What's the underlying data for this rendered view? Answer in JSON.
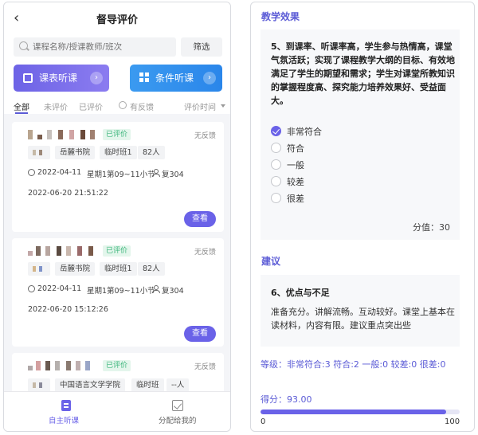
{
  "header": {
    "title": "督导评价"
  },
  "search": {
    "placeholder": "课程名称/授课教师/班次",
    "filter_label": "筛选"
  },
  "big_buttons": {
    "schedule": "课表听课",
    "condition": "条件听课"
  },
  "tabs": [
    "全部",
    "未评价",
    "已评价",
    "有反馈",
    "评价时间"
  ],
  "cards": [
    {
      "badge": "已评价",
      "feedback": "无反馈",
      "tags": [
        "岳麓书院",
        "临时班1",
        "82人"
      ],
      "date": "2022-04-11",
      "period": "星期1第09~11小节",
      "room": "复304",
      "timestamp": "2022-06-20 21:51:22",
      "action": "查看"
    },
    {
      "badge": "已评价",
      "feedback": "无反馈",
      "tags": [
        "岳麓书院",
        "临时班1",
        "82人"
      ],
      "date": "2022-04-11",
      "period": "星期1第09~11小节",
      "room": "复304",
      "timestamp": "2022-06-20 15:12:26",
      "action": "查看"
    },
    {
      "badge": "已评价",
      "feedback": "无反馈",
      "tags": [
        "中国语言文学学院",
        "临时班",
        "--人"
      ]
    }
  ],
  "bottom_nav": {
    "self": "自主听课",
    "assigned": "分配给我的"
  },
  "right": {
    "section1": "教学效果",
    "question": "5、到课率、听课率高，学生参与热情高，课堂气氛活跃；实现了课程教学大纲的目标、有效地满足了学生的期望和需求；学生对课堂所教知识的掌握程度高、探究能力培养效果好、受益面大。",
    "options": [
      "非常符合",
      "符合",
      "一般",
      "较差",
      "很差"
    ],
    "selected_option": "非常符合",
    "score": "分值：30",
    "section2": "建议",
    "suggestion_title": "6、优点与不足",
    "suggestion_text": "准备充分。讲解流畅。互动较好。课堂上基本在读材料，内容有限。建议重点突出些",
    "summary": "等级：非常符合:3 符合:2 一般:0 较差:0 很差:0",
    "total": "得分：93.00",
    "progress": {
      "value": 93,
      "min": "0",
      "max": "100"
    }
  },
  "colors": {
    "accent": "#6a62e8",
    "blue": "#2a86ea",
    "green": "#3ab57a"
  }
}
